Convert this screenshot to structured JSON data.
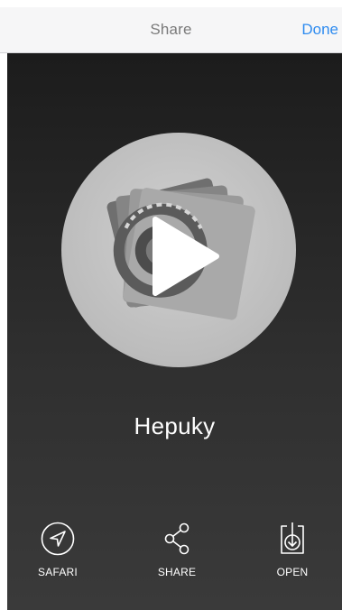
{
  "nav": {
    "title": "Share",
    "done_label": "Done"
  },
  "app": {
    "name": "Hepuky",
    "artwork_icon": "photo-stack-eye-icon",
    "play_icon": "play-icon"
  },
  "actions": [
    {
      "label": "SAFARI",
      "icon": "compass-arrow-icon"
    },
    {
      "label": "SHARE",
      "icon": "share-nodes-icon"
    },
    {
      "label": "OPEN",
      "icon": "open-download-icon"
    }
  ],
  "colors": {
    "accent": "#2f8cf0",
    "nav_background": "#f6f6f7",
    "content_background": "#262626",
    "text_light": "#ffffff"
  }
}
